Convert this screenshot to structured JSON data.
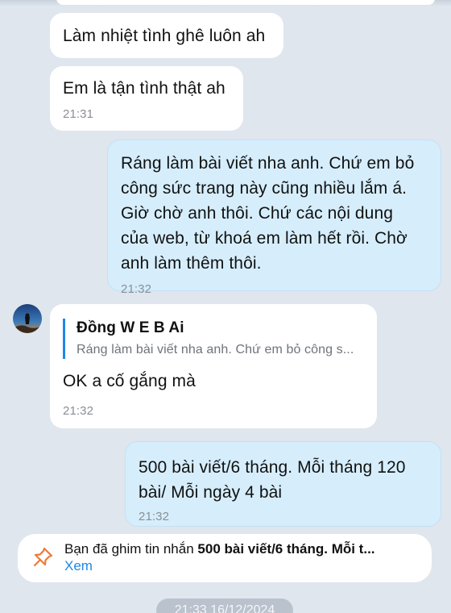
{
  "messages": [
    {
      "text": "Làm nhiệt tình ghê luôn ah",
      "time": ""
    },
    {
      "text": "Em là tận tình thật ah",
      "time": "21:31"
    },
    {
      "text": "Ráng làm bài viết nha anh. Chứ em bỏ\ncông sức trang này cũng nhiều lắm á.\nGiờ chờ anh thôi. Chứ các nội dung\ncủa web, từ khoá em làm hết rồi. Chờ\nanh làm thêm thôi.",
      "time": "21:32"
    },
    {
      "quote_author": "Đồng W E B Ai",
      "quote_text": "Ráng làm bài viết nha anh. Chứ em bỏ công s...",
      "text": "OK a cố gắng mà",
      "time": "21:32"
    },
    {
      "text": "500 bài viết/6 tháng. Mỗi tháng 120\nbài/ Mỗi ngày 4 bài",
      "time": "21:32"
    }
  ],
  "pinned": {
    "prefix": "Bạn đã ghim tin nhắn ",
    "strong": "500 bài viết/6 tháng. Mỗi t...",
    "view_label": "Xem"
  },
  "date_chip": "21:33 16/12/2024",
  "colors": {
    "background": "#dfe6ee",
    "incoming": "#ffffff",
    "outgoing": "#d6eefc",
    "accent": "#1e88e5",
    "pin": "#ee7a3a"
  },
  "icons": {
    "pin": "pin-icon",
    "avatar": "avatar"
  }
}
